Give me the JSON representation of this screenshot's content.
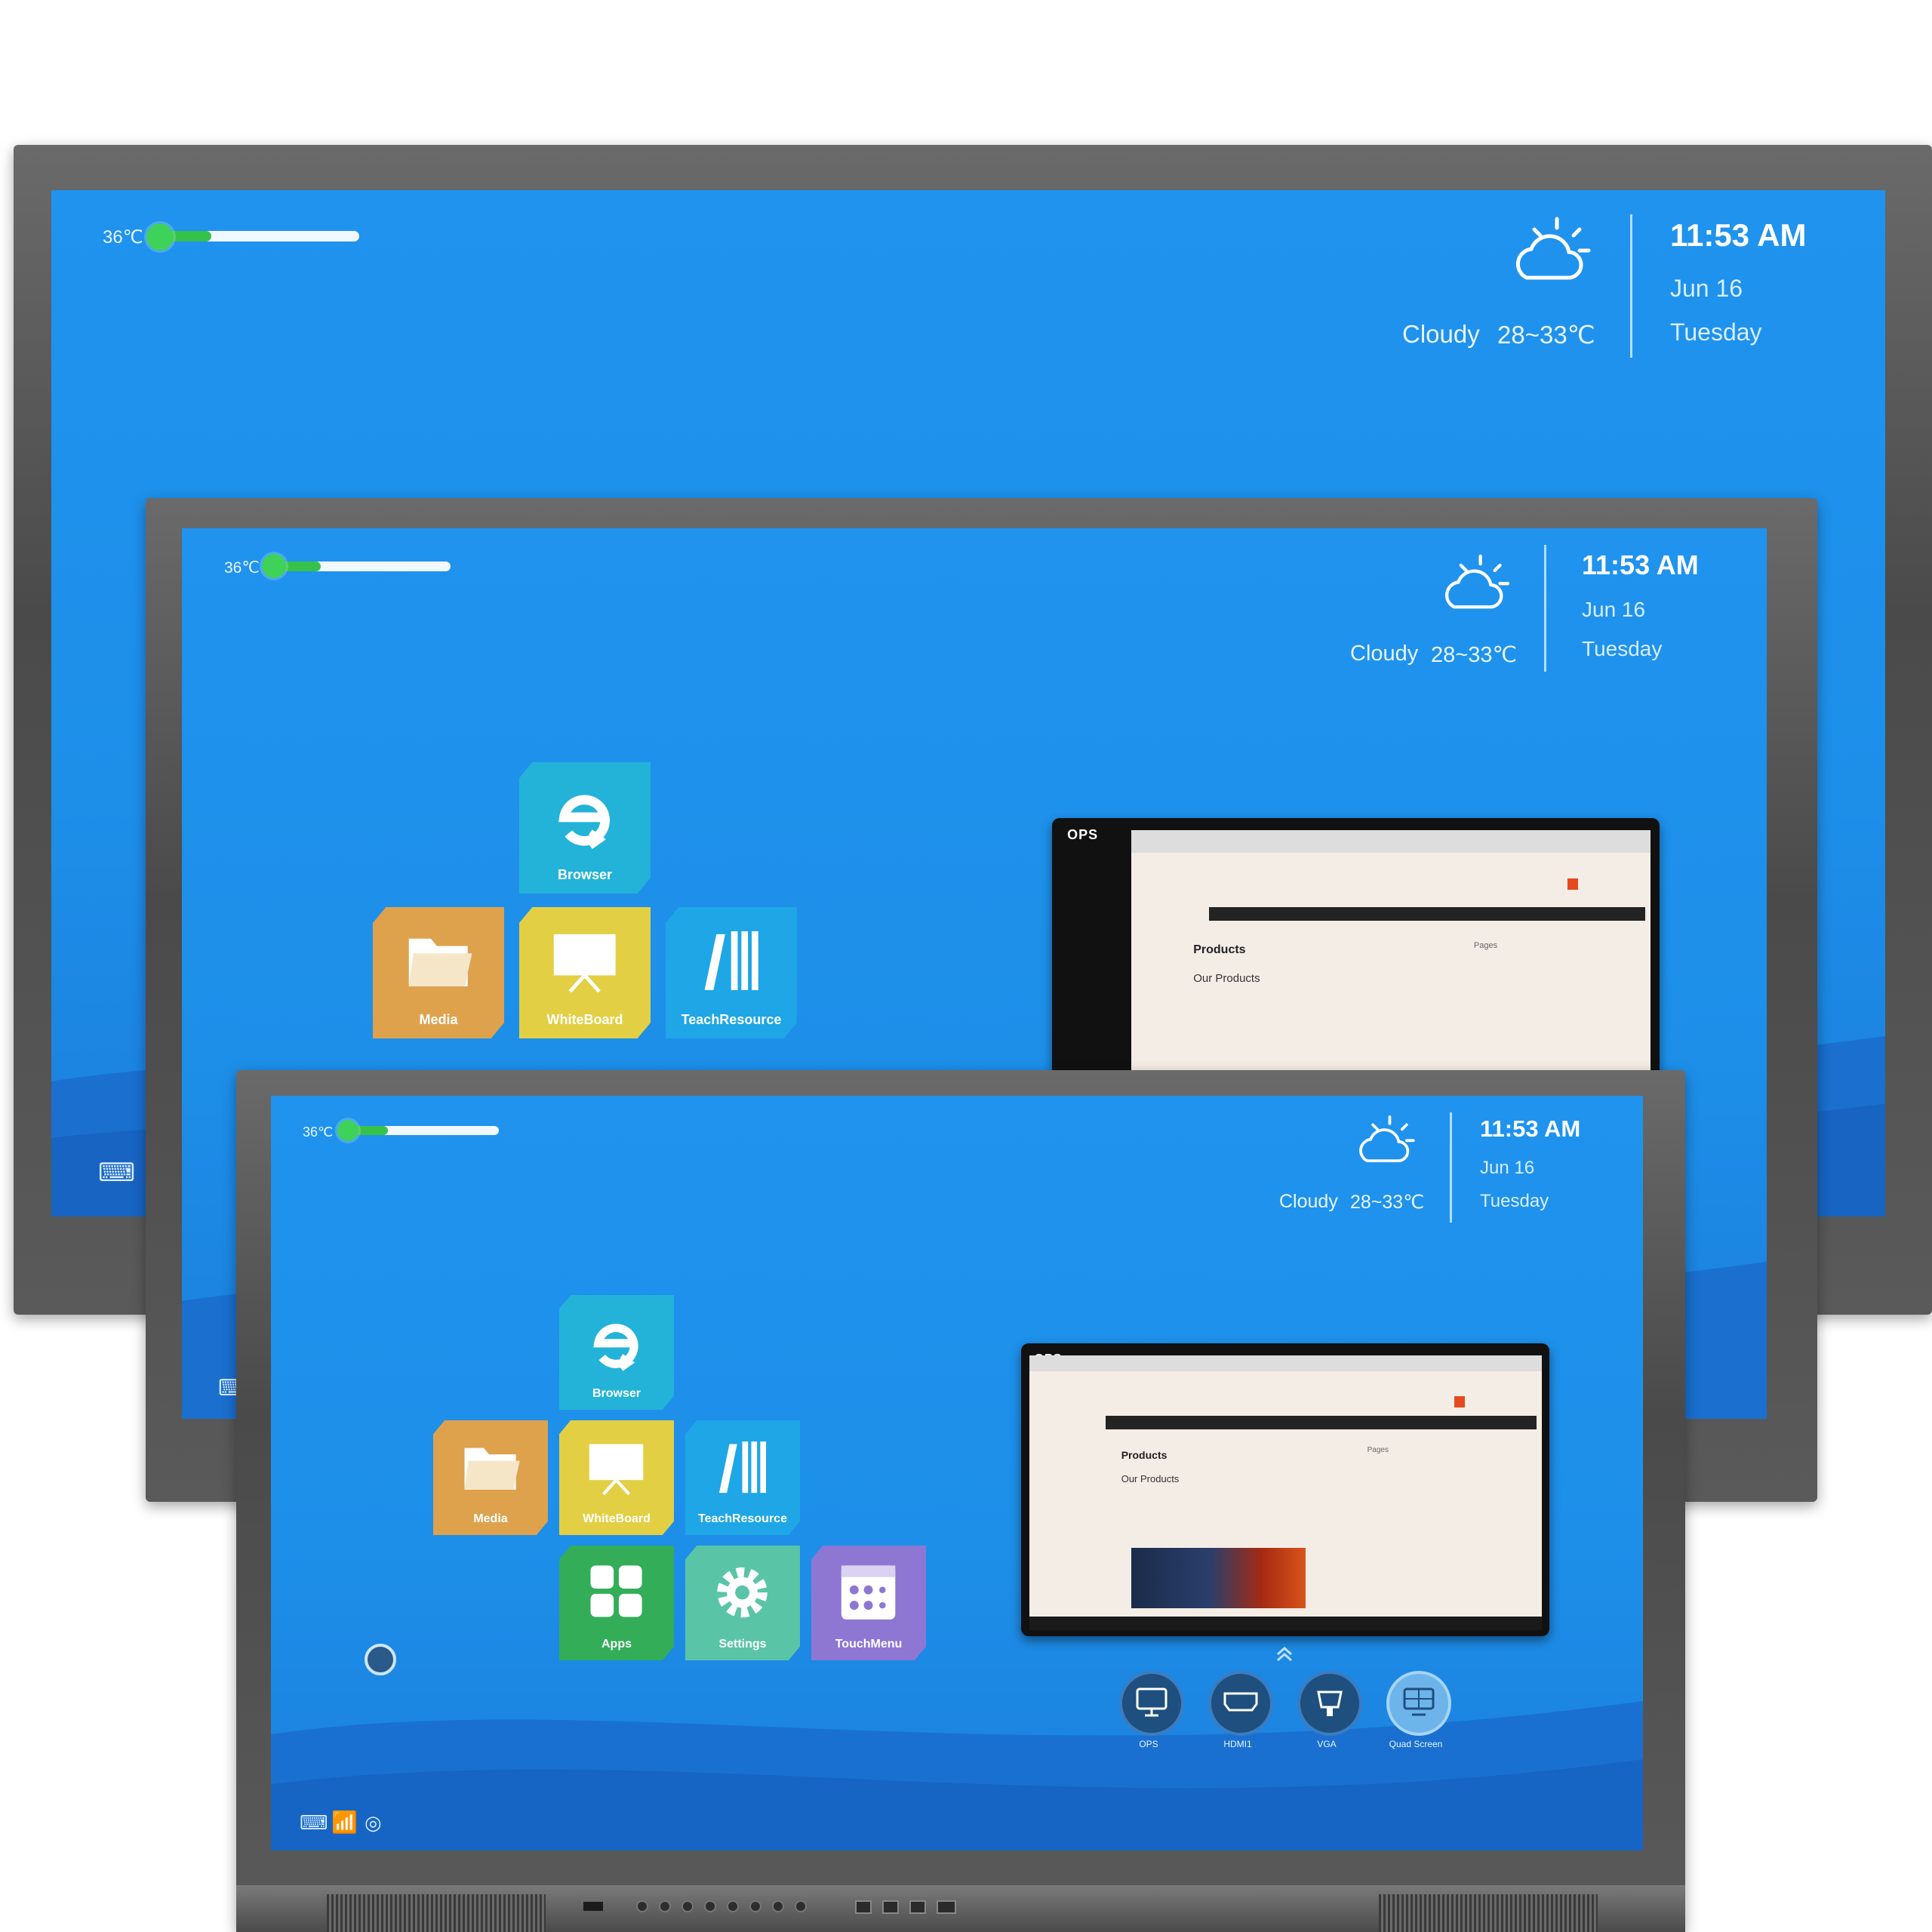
{
  "temperature": {
    "label": "36℃",
    "level_percent": 30
  },
  "weather": {
    "condition": "Cloudy",
    "range": "28~33℃"
  },
  "clock": {
    "time": "11:53 AM",
    "date": "Jun 16",
    "weekday": "Tuesday"
  },
  "apps": [
    {
      "label": "Browser",
      "icon": "browser-e-icon",
      "color": "#23b3d8"
    },
    {
      "label": "Media",
      "icon": "folder-icon",
      "color": "#dea24d"
    },
    {
      "label": "WhiteBoard",
      "icon": "whiteboard-icon",
      "color": "#e3cf43"
    },
    {
      "label": "TeachResource",
      "icon": "books-icon",
      "color": "#1ea6e6"
    },
    {
      "label": "Apps",
      "icon": "apps-grid-icon",
      "color": "#33ad57"
    },
    {
      "label": "Settings",
      "icon": "gear-icon",
      "color": "#5ac4a7"
    },
    {
      "label": "TouchMenu",
      "icon": "touch-menu-icon",
      "color": "#8d77d3"
    }
  ],
  "preview": {
    "source_label": "OPS",
    "page_heading": "Products",
    "page_subheading": "Our Products",
    "sidebar_heading": "Pages"
  },
  "sources": [
    {
      "label": "OPS",
      "icon": "ops-monitor-icon"
    },
    {
      "label": "HDMI1",
      "icon": "hdmi-icon"
    },
    {
      "label": "VGA",
      "icon": "vga-icon"
    },
    {
      "label": "Quad Screen",
      "icon": "quad-screen-icon"
    }
  ],
  "colors": {
    "accent_green": "#36c24a",
    "screen_blue": "#1f93ee"
  }
}
